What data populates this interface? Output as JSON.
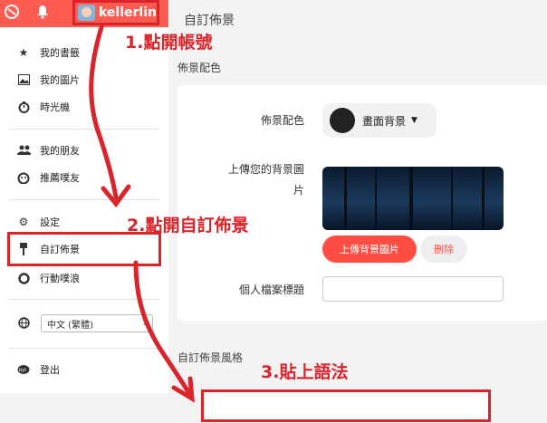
{
  "header": {
    "account_name": "kellerlin",
    "page_title": "自訂佈景"
  },
  "sidebar": {
    "items": [
      {
        "label": "我的書籤",
        "icon": "star-icon"
      },
      {
        "label": "我的圖片",
        "icon": "image-icon"
      },
      {
        "label": "時光機",
        "icon": "timer-icon"
      },
      {
        "label": "我的朋友",
        "icon": "people-icon"
      },
      {
        "label": "推薦噗友",
        "icon": "suggest-icon"
      },
      {
        "label": "設定",
        "icon": "gear-icon"
      },
      {
        "label": "自訂佈景",
        "icon": "brush-icon"
      },
      {
        "label": "行動噗浪",
        "icon": "mobile-icon"
      },
      {
        "label": "登出",
        "icon": "logout-icon"
      }
    ],
    "language_value": "中文 (繁體)"
  },
  "main": {
    "section1_title": "佈景配色",
    "color_label": "佈景配色",
    "color_value": "畫面背景",
    "upload_label_line1": "上傳您的背景圖",
    "upload_label_line2": "片",
    "upload_button": "上傳背景圖片",
    "delete_button": "刪除",
    "profile_title_label": "個人檔案標題",
    "section2_title": "自訂佈景風格"
  },
  "annotations": {
    "step1": "1.點開帳號",
    "step2": "2.點開自訂佈景",
    "step3": "3.貼上語法"
  },
  "colors": {
    "brand_red": "#ff5b50",
    "annotation_red": "#d9242b"
  }
}
